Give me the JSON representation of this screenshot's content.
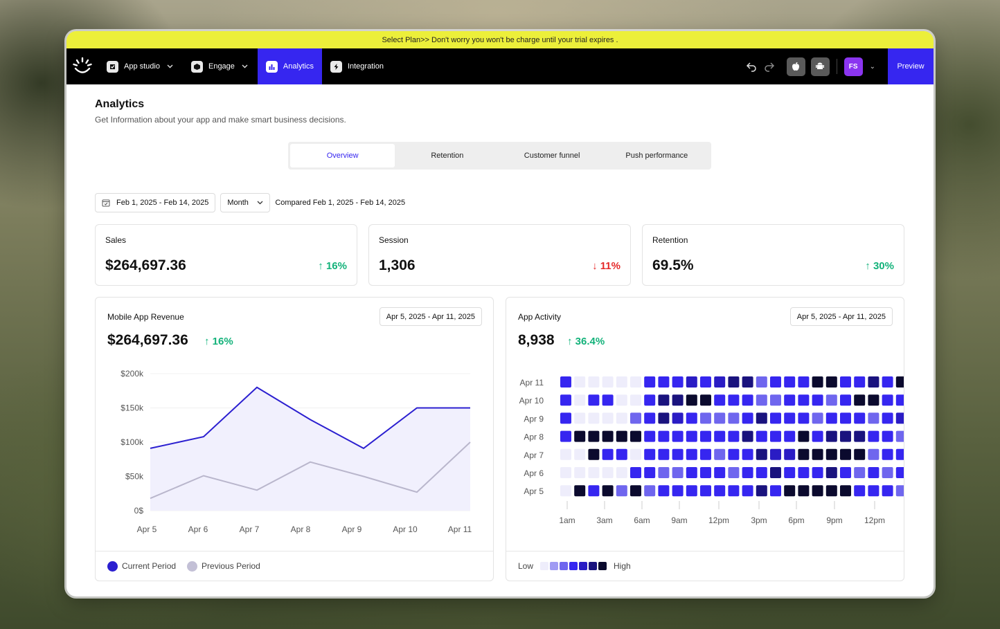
{
  "banner": {
    "text": "Select Plan>> Don't worry you won't be charge until your trial expires ."
  },
  "nav": {
    "items": [
      {
        "label": "App studio",
        "icon": "puzzle-icon",
        "caret": true,
        "active": false
      },
      {
        "label": "Engage",
        "icon": "cube-icon",
        "caret": true,
        "active": false
      },
      {
        "label": "Analytics",
        "icon": "bar-chart-icon",
        "caret": false,
        "active": true
      },
      {
        "label": "Integration",
        "icon": "lightning-icon",
        "caret": false,
        "active": false
      }
    ],
    "avatar_initials": "FS",
    "preview_label": "Preview"
  },
  "page": {
    "title": "Analytics",
    "subtitle": "Get Information about your app and make smart business decisions."
  },
  "tabs": [
    {
      "label": "Overview",
      "active": true
    },
    {
      "label": "Retention",
      "active": false
    },
    {
      "label": "Customer funnel",
      "active": false
    },
    {
      "label": "Push performance",
      "active": false
    }
  ],
  "filters": {
    "date_range": "Feb 1, 2025 - Feb 14, 2025",
    "period": "Month",
    "compared": "Compared Feb 1, 2025 - Feb 14, 2025"
  },
  "kpis": [
    {
      "label": "Sales",
      "value": "$264,697.36",
      "change": "16%",
      "direction": "up"
    },
    {
      "label": "Session",
      "value": "1,306",
      "change": "11%",
      "direction": "down"
    },
    {
      "label": "Retention",
      "value": "69.5%",
      "change": "30%",
      "direction": "up"
    }
  ],
  "revenue_card": {
    "title": "Mobile App Revenue",
    "date_range": "Apr 5, 2025 - Apr 11, 2025",
    "value": "$264,697.36",
    "change": "16%",
    "legend_current": "Current Period",
    "legend_previous": "Previous Period"
  },
  "activity_card": {
    "title": "App Activity",
    "date_range": "Apr 5, 2025 - Apr 11, 2025",
    "value": "8,938",
    "change": "36.4%",
    "legend_low": "Low",
    "legend_high": "High"
  },
  "colors": {
    "accent": "#3626f0",
    "up": "#13b27a",
    "down": "#e52a2a",
    "banner": "#ecef3a",
    "current_line": "#2b1fd0",
    "previous_line": "#b9b6cc",
    "heat_levels": [
      "#eeedfb",
      "#a09bf3",
      "#6f66ee",
      "#3626f0",
      "#2a1cc4",
      "#1a137e",
      "#0b0a2e"
    ]
  },
  "chart_data": [
    {
      "type": "area",
      "x": [
        "Apr 5",
        "Apr 6",
        "Apr 7",
        "Apr 8",
        "Apr 9",
        "Apr 10",
        "Apr 11"
      ],
      "series": [
        {
          "name": "Current Period",
          "values": [
            91000,
            108000,
            180000,
            133000,
            91000,
            150000,
            150000
          ]
        },
        {
          "name": "Previous Period",
          "values": [
            18000,
            51000,
            30000,
            71000,
            50000,
            27000,
            100000
          ]
        }
      ],
      "xlabel": "",
      "ylabel": "",
      "yticks": [
        "0$",
        "$50k",
        "$100k",
        "$150k",
        "$200k"
      ],
      "ylim": [
        0,
        200000
      ],
      "grid": true,
      "legend": "bottom-left"
    },
    {
      "type": "heatmap",
      "rows": [
        "Apr 11",
        "Apr 10",
        "Apr 9",
        "Apr 8",
        "Apr 7",
        "Apr 6",
        "Apr 5"
      ],
      "xticks": [
        "1am",
        "3am",
        "6am",
        "9am",
        "12pm",
        "3pm",
        "6pm",
        "9pm",
        "12pm"
      ],
      "levels": 7,
      "values": [
        [
          3,
          0,
          0,
          0,
          0,
          0,
          3,
          3,
          3,
          4,
          3,
          4,
          5,
          5,
          2,
          3,
          3,
          3,
          6,
          6,
          3,
          3,
          5,
          3,
          6
        ],
        [
          3,
          0,
          3,
          3,
          0,
          0,
          3,
          5,
          5,
          6,
          6,
          3,
          3,
          3,
          2,
          2,
          3,
          3,
          3,
          2,
          3,
          6,
          6,
          3,
          3
        ],
        [
          3,
          0,
          0,
          0,
          0,
          2,
          3,
          5,
          4,
          3,
          2,
          2,
          2,
          3,
          5,
          3,
          3,
          3,
          2,
          3,
          3,
          3,
          2,
          3,
          4
        ],
        [
          3,
          6,
          6,
          6,
          6,
          6,
          3,
          3,
          3,
          3,
          3,
          3,
          3,
          5,
          3,
          3,
          3,
          6,
          3,
          5,
          5,
          5,
          3,
          3,
          2
        ],
        [
          0,
          0,
          6,
          3,
          3,
          0,
          3,
          3,
          3,
          3,
          3,
          2,
          3,
          3,
          5,
          4,
          4,
          6,
          6,
          6,
          6,
          6,
          2,
          3,
          3
        ],
        [
          0,
          0,
          0,
          0,
          0,
          3,
          3,
          2,
          2,
          3,
          3,
          3,
          2,
          3,
          3,
          5,
          3,
          3,
          3,
          5,
          3,
          2,
          3,
          2,
          3
        ],
        [
          0,
          6,
          3,
          6,
          2,
          6,
          2,
          3,
          3,
          3,
          3,
          3,
          3,
          3,
          5,
          3,
          6,
          6,
          6,
          6,
          6,
          3,
          3,
          3,
          2
        ]
      ],
      "legend": "bottom-left"
    }
  ]
}
